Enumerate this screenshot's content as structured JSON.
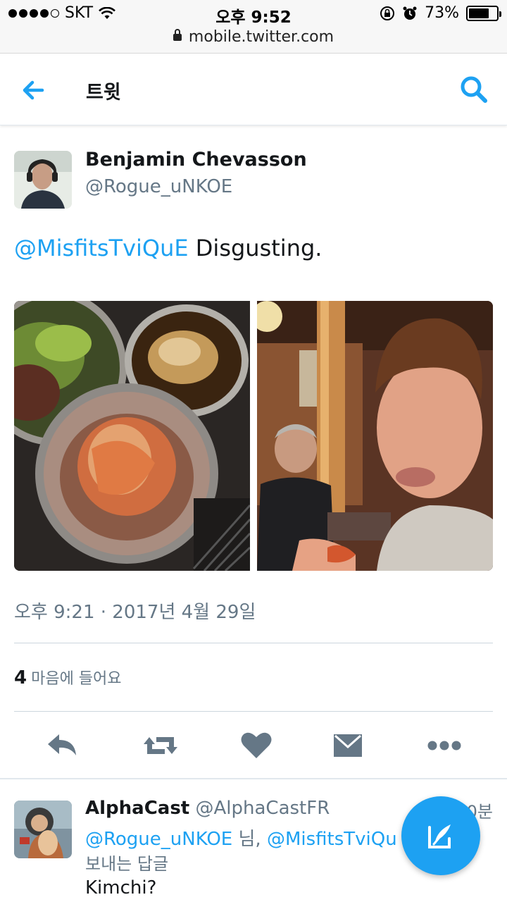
{
  "status_bar": {
    "carrier": "SKT",
    "time": "오후 9:52",
    "battery_percent": "73%",
    "battery_level": 0.73
  },
  "browser": {
    "url": "mobile.twitter.com"
  },
  "header": {
    "title": "트윗",
    "back_icon": "back-arrow-icon",
    "search_icon": "search-icon"
  },
  "tweet": {
    "author_name": "Benjamin Chevasson",
    "author_handle": "@Rogue_uNKOE",
    "mention": "@MisfitsTviQuE",
    "text": " Disgusting.",
    "timestamp": "오후 9:21 · 2017년 4월 29일",
    "likes_count": "4",
    "likes_label": "마음에 들어요"
  },
  "actions": [
    {
      "name": "reply-icon"
    },
    {
      "name": "retweet-icon"
    },
    {
      "name": "like-icon"
    },
    {
      "name": "message-icon"
    },
    {
      "name": "more-icon"
    }
  ],
  "reply": {
    "name": "AlphaCast",
    "handle": "@AlphaCastFR",
    "time": "0분",
    "to_mention1": "@Rogue_uNKOE",
    "to_nim": " 님, ",
    "to_mention2": "@MisfitsTviQu",
    "sub": "보내는 답글",
    "text": "Kimchi?"
  },
  "colors": {
    "accent": "#1da1f2",
    "secondary_text": "#657786",
    "primary_text": "#14171a"
  }
}
